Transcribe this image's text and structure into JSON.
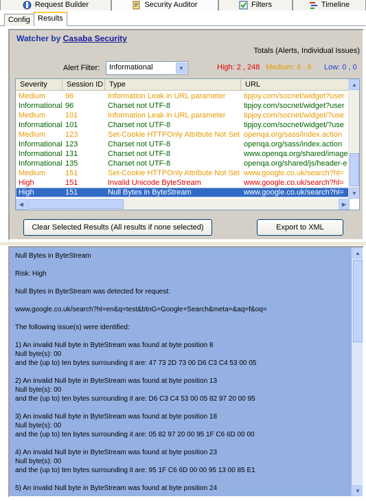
{
  "top_tabs": [
    {
      "label": "Request Builder",
      "icon": "request-builder-icon"
    },
    {
      "label": "Security Auditor",
      "icon": "security-auditor-icon"
    },
    {
      "label": "Filters",
      "icon": "filters-checkbox-icon"
    },
    {
      "label": "Timeline",
      "icon": "timeline-icon"
    }
  ],
  "sub_tabs": [
    {
      "label": "Config"
    },
    {
      "label": "Results"
    }
  ],
  "watcher": {
    "prefix": "Watcher by ",
    "link": "Casaba Security"
  },
  "totals_label": "Totals (Alerts, Individual Issues)",
  "filter": {
    "label": "Alert Filter:",
    "value": "Informational"
  },
  "counts": {
    "high": "High: 2 , 248",
    "medium": "Medium: 6 , 6",
    "low": "Low: 0 , 0"
  },
  "colors": {
    "high": "#e00000",
    "medium": "#e89a00",
    "informational": "#006400",
    "selected_bg": "#316ac5",
    "details_bg": "#95b1e3"
  },
  "grid": {
    "columns": [
      "Severity",
      "Session ID",
      "Type",
      "URL"
    ],
    "rows": [
      {
        "severity": "Medium",
        "session": "96",
        "type": "Information Leak in URL parameter",
        "url": "tipjoy.com/socnet/widget?user",
        "level": "medium"
      },
      {
        "severity": "Informational",
        "session": "96",
        "type": "Charset not UTF-8",
        "url": "tipjoy.com/socnet/widget?user",
        "level": "informational"
      },
      {
        "severity": "Medium",
        "session": "101",
        "type": "Information Leak in URL parameter",
        "url": "tipjoy.com/socnet/widget/?use",
        "level": "medium"
      },
      {
        "severity": "Informational",
        "session": "101",
        "type": "Charset not UTF-8",
        "url": "tipjoy.com/socnet/widget/?use",
        "level": "informational"
      },
      {
        "severity": "Medium",
        "session": "123",
        "type": "Set-Cookie HTTPOnly Attribute Not Set",
        "url": "openqa.org/sass/index.action",
        "level": "medium"
      },
      {
        "severity": "Informational",
        "session": "123",
        "type": "Charset not UTF-8",
        "url": "openqa.org/sass/index.action",
        "level": "informational"
      },
      {
        "severity": "Informational",
        "session": "131",
        "type": "Charset not UTF-8",
        "url": "www.openqa.org/shared/image",
        "level": "informational"
      },
      {
        "severity": "Informational",
        "session": "135",
        "type": "Charset not UTF-8",
        "url": "openqa.org/shared/js/header-e",
        "level": "informational"
      },
      {
        "severity": "Medium",
        "session": "151",
        "type": "Set-Cookie HTTPOnly Attribute Not Set",
        "url": "www.google.co.uk/search?hl=",
        "level": "medium"
      },
      {
        "severity": "High",
        "session": "151",
        "type": "Invalid Unicode ByteStream",
        "url": "www.google.co.uk/search?hl=",
        "level": "high"
      },
      {
        "severity": "High",
        "session": "151",
        "type": "Null Bytes in ByteStream",
        "url": "www.google.co.uk/search?hl=",
        "level": "high",
        "selected": true
      }
    ]
  },
  "buttons": {
    "clear": "Clear Selected Results (All results if none selected)",
    "export": "Export to XML"
  },
  "details_text": "Null Bytes in ByteStream\n\nRisk: High\n\nNull Bytes in ByteStream was detected for request:\n\nwww.google.co.uk/search?hl=en&q=test&btnG=Google+Search&meta=&aq=f&oq=\n\nThe following issue(s) were identified:\n\n1) An invalid Null byte in ByteStream was found at byte position 8\nNull byte(s): 00\nand the (up to) ten bytes surrounding it are: 47 73 2D 73 00 D6 C3 C4 53 00 05\n\n2) An invalid Null byte in ByteStream was found at byte position 13\nNull byte(s): 00\nand the (up to) ten bytes surrounding it are: D6 C3 C4 53 00 05 82 97 20 00 95\n\n3) An invalid Null byte in ByteStream was found at byte position 18\nNull byte(s): 00\nand the (up to) ten bytes surrounding it are: 05 82 97 20 00 95 1F C6 6D 00 00\n\n4) An invalid Null byte in ByteStream was found at byte position 23\nNull byte(s): 00\nand the (up to) ten bytes surrounding it are: 95 1F C6 6D 00 00 95 13 00 85 E1\n\n5) An invalid Null byte in ByteStream was found at byte position 24"
}
